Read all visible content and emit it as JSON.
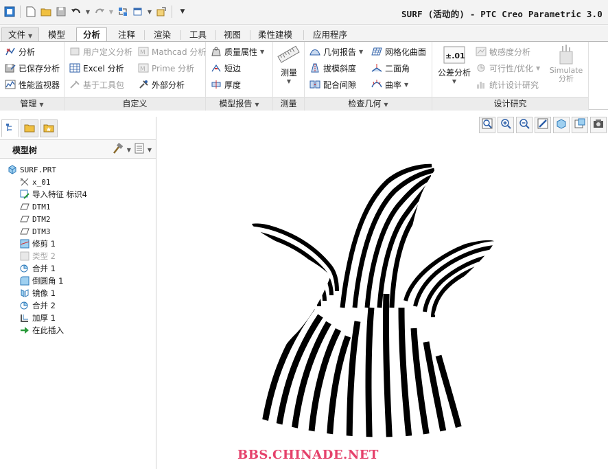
{
  "window": {
    "title": "SURF (活动的) - PTC Creo Parametric 3.0"
  },
  "quick_access": [
    "app-icon",
    "new-icon",
    "open-icon",
    "save-icon",
    "undo-icon",
    "redo-icon",
    "regenerate-icon",
    "windows-icon",
    "close-window-icon",
    "customize-icon"
  ],
  "tabs": [
    {
      "label": "文件",
      "dropdown": true
    },
    {
      "label": "模型"
    },
    {
      "label": "分析",
      "active": true
    },
    {
      "label": "注释"
    },
    {
      "label": "渲染"
    },
    {
      "label": "工具"
    },
    {
      "label": "视图"
    },
    {
      "label": "柔性建模"
    },
    {
      "label": "应用程序"
    }
  ],
  "ribbon": {
    "manage": {
      "label": "管理",
      "items": [
        {
          "label": "分析",
          "icon": "analysis-icon"
        },
        {
          "label": "已保存分析",
          "icon": "saved-analysis-icon"
        },
        {
          "label": "性能监视器",
          "icon": "performance-monitor-icon"
        }
      ]
    },
    "custom": {
      "label": "自定义",
      "items": [
        {
          "label": "用户定义分析",
          "icon": "user-defined-analysis-icon",
          "disabled": true
        },
        {
          "label": "Excel 分析",
          "icon": "excel-icon"
        },
        {
          "label": "基于工具包",
          "icon": "toolkit-icon",
          "disabled": true
        },
        {
          "label": "Mathcad 分析",
          "icon": "mathcad-icon",
          "disabled": true
        },
        {
          "label": "Prime 分析",
          "icon": "prime-icon",
          "disabled": true
        },
        {
          "label": "外部分析",
          "icon": "external-analysis-icon"
        }
      ]
    },
    "model_report": {
      "label": "模型报告",
      "items": [
        {
          "label": "质量属性",
          "icon": "mass-properties-icon"
        },
        {
          "label": "短边",
          "icon": "short-edge-icon"
        },
        {
          "label": "厚度",
          "icon": "thickness-icon"
        }
      ]
    },
    "measure": {
      "label": "测量",
      "button": "测量"
    },
    "inspect": {
      "label": "检查几何",
      "items": [
        {
          "label": "几何报告",
          "icon": "geometry-report-icon"
        },
        {
          "label": "拔模斜度",
          "icon": "draft-icon"
        },
        {
          "label": "配合间隙",
          "icon": "clearance-icon"
        },
        {
          "label": "网格化曲面",
          "icon": "mesh-surface-icon"
        },
        {
          "label": "二面角",
          "icon": "dihedral-angle-icon"
        },
        {
          "label": "曲率",
          "icon": "curvature-icon"
        }
      ]
    },
    "design_study": {
      "label": "设计研究",
      "tolerance_button": "公差分析",
      "tolerance_glyph": "±.01",
      "items": [
        {
          "label": "敏感度分析",
          "icon": "sensitivity-icon",
          "disabled": true
        },
        {
          "label": "可行性/优化",
          "icon": "optimization-icon",
          "disabled": true
        },
        {
          "label": "统计设计研究",
          "icon": "statistical-icon",
          "disabled": true
        }
      ],
      "simulate_line1": "Simulate",
      "simulate_line2": "分析"
    }
  },
  "model_tree": {
    "header": "模型树",
    "root": "SURF.PRT",
    "items": [
      {
        "label": "x_01",
        "icon": "csys-icon",
        "mono": true
      },
      {
        "label": "导入特征 标识4",
        "icon": "import-feature-icon"
      },
      {
        "label": "DTM1",
        "icon": "datum-plane-icon",
        "mono": true
      },
      {
        "label": "DTM2",
        "icon": "datum-plane-icon",
        "mono": true
      },
      {
        "label": "DTM3",
        "icon": "datum-plane-icon",
        "mono": true
      },
      {
        "label": "修剪 1",
        "icon": "trim-icon"
      },
      {
        "label": "类型 2",
        "icon": "type-icon",
        "disabled": true
      },
      {
        "label": "合并 1",
        "icon": "merge-icon"
      },
      {
        "label": "倒圆角 1",
        "icon": "round-icon"
      },
      {
        "label": "镜像 1",
        "icon": "mirror-icon"
      },
      {
        "label": "合并 2",
        "icon": "merge-icon"
      },
      {
        "label": "加厚 1",
        "icon": "thicken-icon"
      },
      {
        "label": "在此插入",
        "icon": "insert-here-icon"
      }
    ]
  },
  "graphics_toolbar": [
    "refit-icon",
    "zoom-in-icon",
    "zoom-out-icon",
    "repaint-icon",
    "display-style-icon",
    "saved-views-icon",
    "view-manager-icon"
  ],
  "watermark": "BBS.CHINADE.NET",
  "colors": {
    "accent": "#2d5fa8",
    "ribbon_footer": "#ececec",
    "watermark": "#e5416b",
    "stripe": "#000000"
  }
}
